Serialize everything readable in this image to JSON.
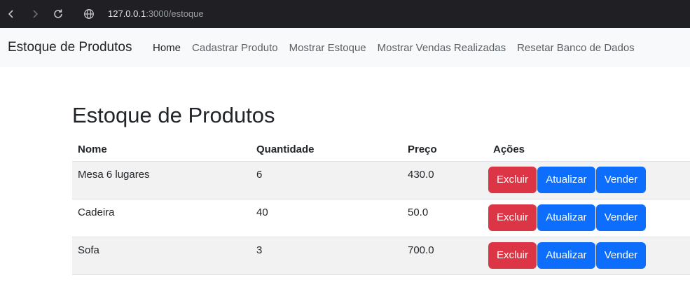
{
  "browser": {
    "url_host": "127.0.0.1",
    "url_rest": ":3000/estoque"
  },
  "navbar": {
    "brand": "Estoque de Produtos",
    "links": [
      {
        "label": "Home",
        "active": true
      },
      {
        "label": "Cadastrar Produto",
        "active": false
      },
      {
        "label": "Mostrar Estoque",
        "active": false
      },
      {
        "label": "Mostrar Vendas Realizadas",
        "active": false
      },
      {
        "label": "Resetar Banco de Dados",
        "active": false
      }
    ]
  },
  "main": {
    "title": "Estoque de Produtos",
    "table": {
      "headers": [
        "Nome",
        "Quantidade",
        "Preço",
        "Ações"
      ],
      "rows": [
        {
          "nome": "Mesa 6 lugares",
          "quantidade": "6",
          "preco": "430.0"
        },
        {
          "nome": "Cadeira",
          "quantidade": "40",
          "preco": "50.0"
        },
        {
          "nome": "Sofa",
          "quantidade": "3",
          "preco": "700.0"
        }
      ],
      "actions": {
        "delete": "Excluir",
        "update": "Atualizar",
        "sell": "Vender"
      }
    }
  },
  "colors": {
    "danger": "#dc3545",
    "primary": "#0d6efd",
    "navbar_bg": "#f8f9fa",
    "chrome_bg": "#1f1f24"
  }
}
